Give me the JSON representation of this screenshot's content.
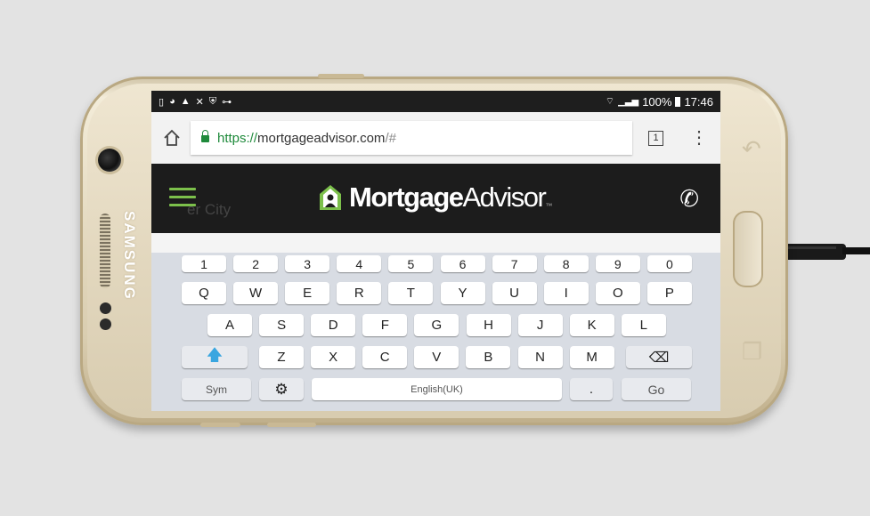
{
  "device": {
    "brand": "SAMSUNG"
  },
  "statusbar": {
    "left_icons": [
      "sim-icon",
      "data-saver-icon",
      "warning-icon",
      "no-signal-icon",
      "shield-icon",
      "key-icon"
    ],
    "battery": "100%",
    "time": "17:46"
  },
  "browser": {
    "url_scheme": "https://",
    "url_host": "mortgageadvisor.com",
    "url_path": "/#",
    "tab_count": "1"
  },
  "site": {
    "logo_main": "Mortgage",
    "logo_light": "Advisor",
    "logo_tm": "™",
    "input_placeholder_partial": "er City"
  },
  "keyboard": {
    "number_row": [
      "1",
      "2",
      "3",
      "4",
      "5",
      "6",
      "7",
      "8",
      "9",
      "0"
    ],
    "row1": [
      "Q",
      "W",
      "E",
      "R",
      "T",
      "Y",
      "U",
      "I",
      "O",
      "P"
    ],
    "row2": [
      "A",
      "S",
      "D",
      "F",
      "G",
      "H",
      "J",
      "K",
      "L"
    ],
    "row3": [
      "Z",
      "X",
      "C",
      "V",
      "B",
      "N",
      "M"
    ],
    "sym_label": "Sym",
    "space_label": "English(UK)",
    "period_label": ".",
    "go_label": "Go"
  }
}
